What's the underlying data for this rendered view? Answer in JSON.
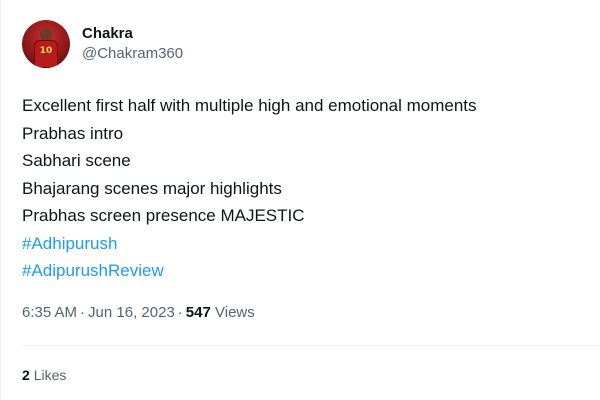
{
  "author": {
    "display_name": "Chakra",
    "handle": "@Chakram360",
    "avatar_icon": "user-avatar-jersey",
    "avatar_jersey_number": "10"
  },
  "tweet": {
    "lines": [
      "Excellent first half with multiple high and emotional moments",
      "Prabhas intro",
      "Sabhari scene",
      "Bhajarang scenes major highlights",
      "Prabhas screen presence MAJESTIC"
    ],
    "hashtags": [
      "#Adhipurush",
      "#AdipurushReview"
    ]
  },
  "meta": {
    "time": "6:35 AM",
    "date": "Jun 16, 2023",
    "views_count": "547",
    "views_label": "Views"
  },
  "engagement": {
    "likes_count": "2",
    "likes_label": "Likes"
  },
  "colors": {
    "text": "#0f1419",
    "secondary": "#536471",
    "link": "#1d9bf0",
    "divider": "#eff3f4"
  }
}
